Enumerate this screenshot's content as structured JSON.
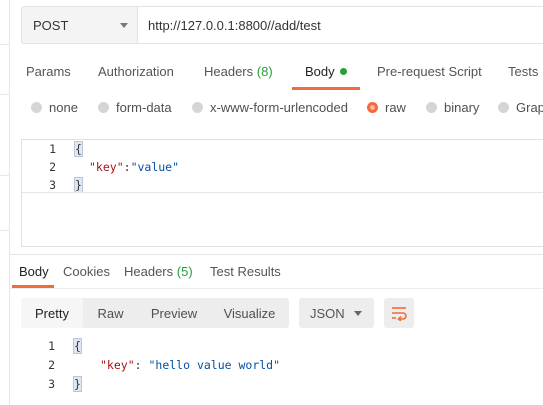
{
  "request": {
    "method": "POST",
    "url": "http://127.0.0.1:8800//add/test"
  },
  "request_tabs": {
    "params": "Params",
    "authorization": "Authorization",
    "headers": "Headers",
    "headers_count": "(8)",
    "body": "Body",
    "pre_request": "Pre-request Script",
    "tests": "Tests"
  },
  "body_types": {
    "none": "none",
    "form_data": "form-data",
    "urlencoded": "x-www-form-urlencoded",
    "raw": "raw",
    "binary": "binary",
    "graphql": "Grap",
    "selected": "raw"
  },
  "request_body": {
    "lines": [
      {
        "num": "1",
        "open": "{"
      },
      {
        "num": "2",
        "key": "\"key\"",
        "sep": ":",
        "value": "\"value\""
      },
      {
        "num": "3",
        "close": "}"
      }
    ]
  },
  "response_tabs": {
    "body": "Body",
    "cookies": "Cookies",
    "headers": "Headers",
    "headers_count": "(5)",
    "test_results": "Test Results"
  },
  "response_view": {
    "pretty": "Pretty",
    "raw": "Raw",
    "preview": "Preview",
    "visualize": "Visualize",
    "format": "JSON"
  },
  "response_body": {
    "lines": [
      {
        "num": "1",
        "open": "{"
      },
      {
        "num": "2",
        "key": "\"key\"",
        "sep": ": ",
        "value": "\"hello value world\""
      },
      {
        "num": "3",
        "close": "}"
      }
    ]
  },
  "colors": {
    "accent": "#f26b3a",
    "count_green": "#2a9d3b",
    "json_key": "#a31515",
    "json_string": "#0451a5"
  }
}
